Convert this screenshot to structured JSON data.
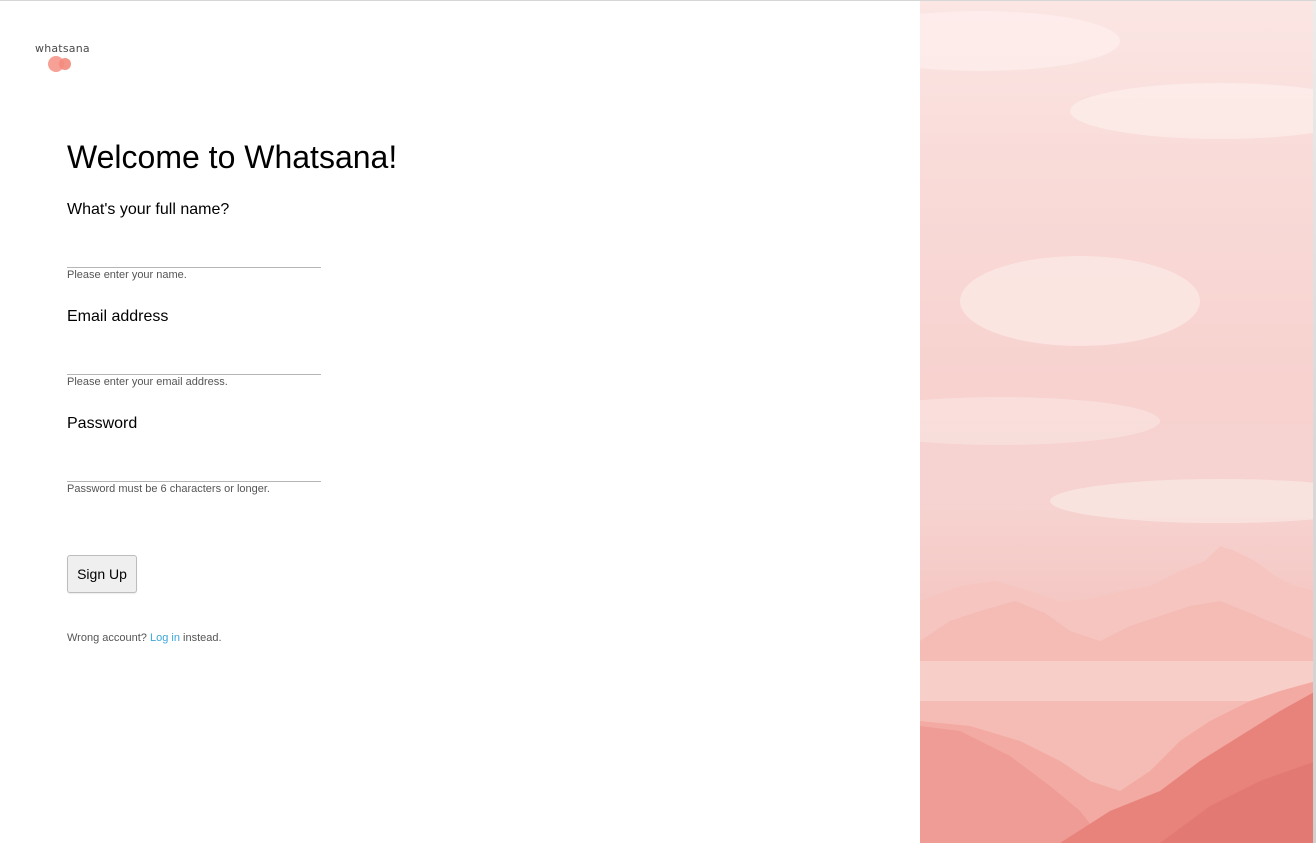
{
  "logo": {
    "text": "whatsana"
  },
  "signup": {
    "title": "Welcome to Whatsana!",
    "fields": [
      {
        "label": "What's your full name?",
        "value": "",
        "hint": "Please enter your name."
      },
      {
        "label": "Email address",
        "value": "",
        "hint": "Please enter your email address."
      },
      {
        "label": "Password",
        "value": "",
        "hint": "Password must be 6 characters or longer."
      }
    ],
    "submit_label": "Sign Up",
    "footer": {
      "prefix": "Wrong account?",
      "link": "Log in",
      "suffix": "instead."
    }
  },
  "colors": {
    "link": "#3ba7d9",
    "logo_accent": "#f7a196",
    "hero_tint": "#f4b8b2"
  }
}
